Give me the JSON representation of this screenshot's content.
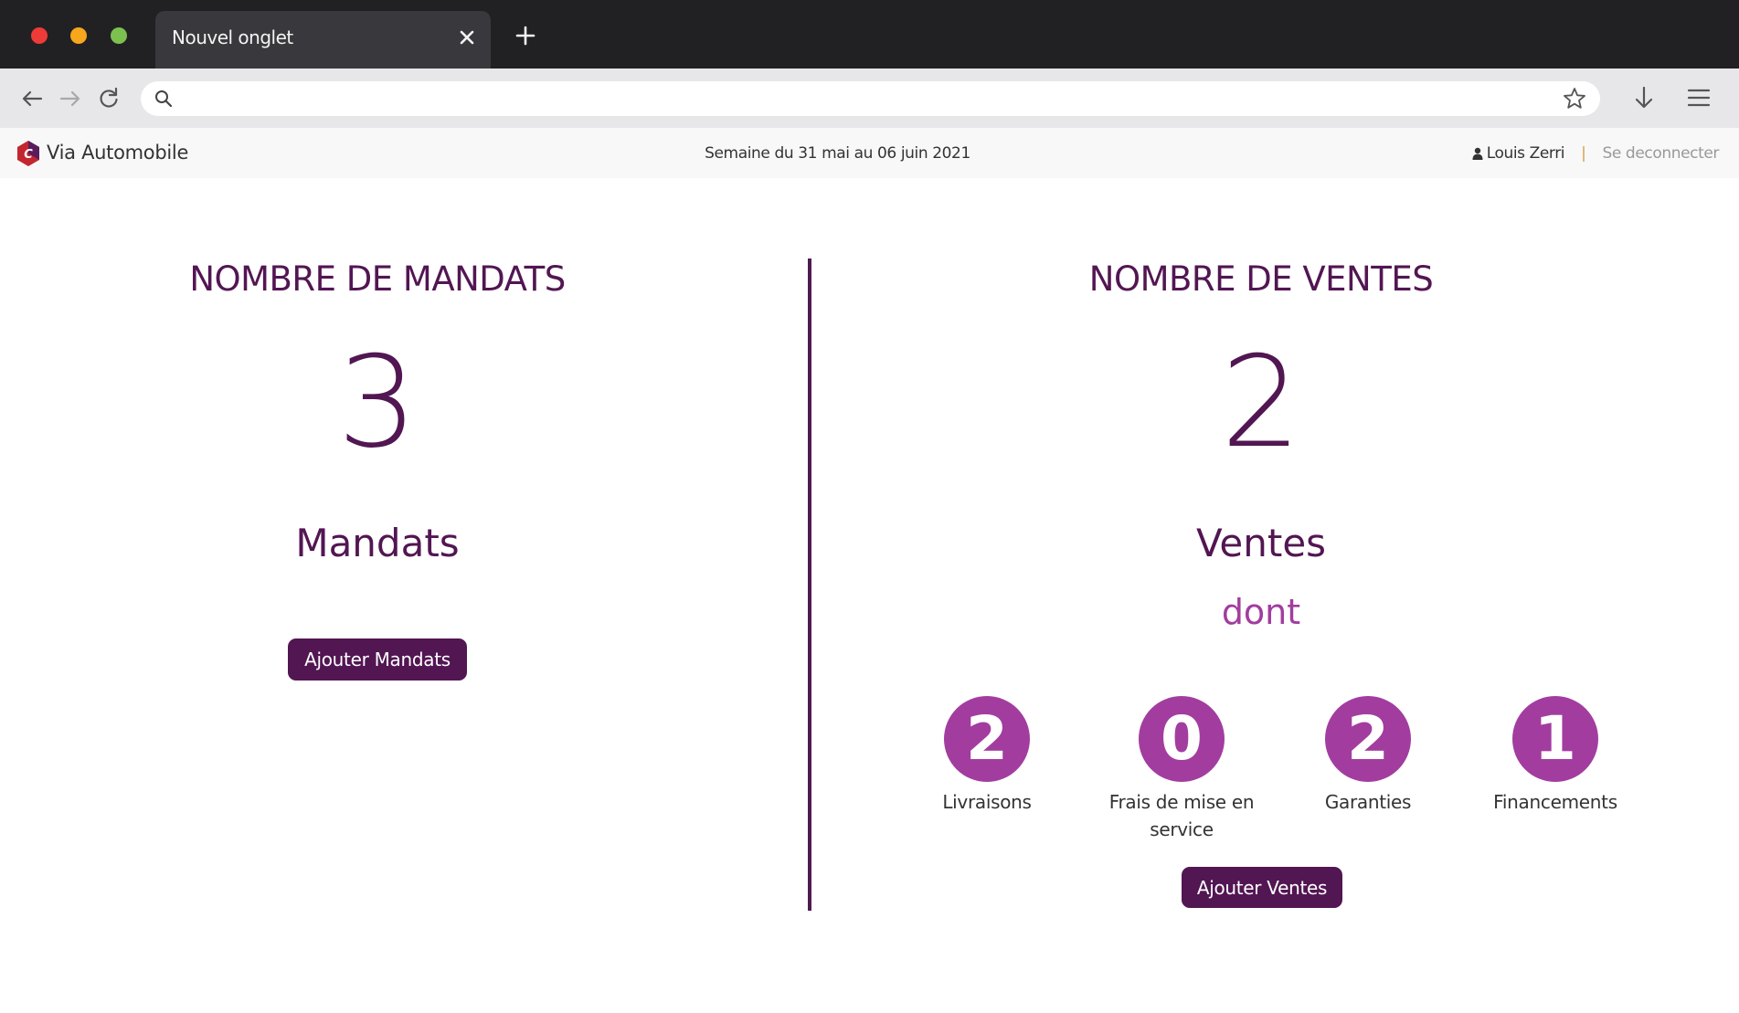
{
  "browser": {
    "tab_title": "Nouvel onglet",
    "url_placeholder": ""
  },
  "header": {
    "brand": "Via Automobile",
    "week": "Semaine du 31 mai au 06 juin 2021",
    "user": "Louis Zerri",
    "separator": "|",
    "logout": "Se deconnecter"
  },
  "mandats": {
    "title": "NOMBRE DE MANDATS",
    "count": "3",
    "label": "Mandats",
    "button": "Ajouter Mandats"
  },
  "ventes": {
    "title": "NOMBRE DE VENTES",
    "count": "2",
    "label": "Ventes",
    "dont": "dont",
    "stats": [
      {
        "value": "2",
        "label": "Livraisons"
      },
      {
        "value": "0",
        "label": "Frais de mise en service"
      },
      {
        "value": "2",
        "label": "Garanties"
      },
      {
        "value": "1",
        "label": "Financements"
      }
    ],
    "button": "Ajouter Ventes"
  },
  "colors": {
    "primary": "#521652",
    "accent": "#a23d9f",
    "tabbar": "#212124",
    "navbar": "#e7e7ea"
  }
}
